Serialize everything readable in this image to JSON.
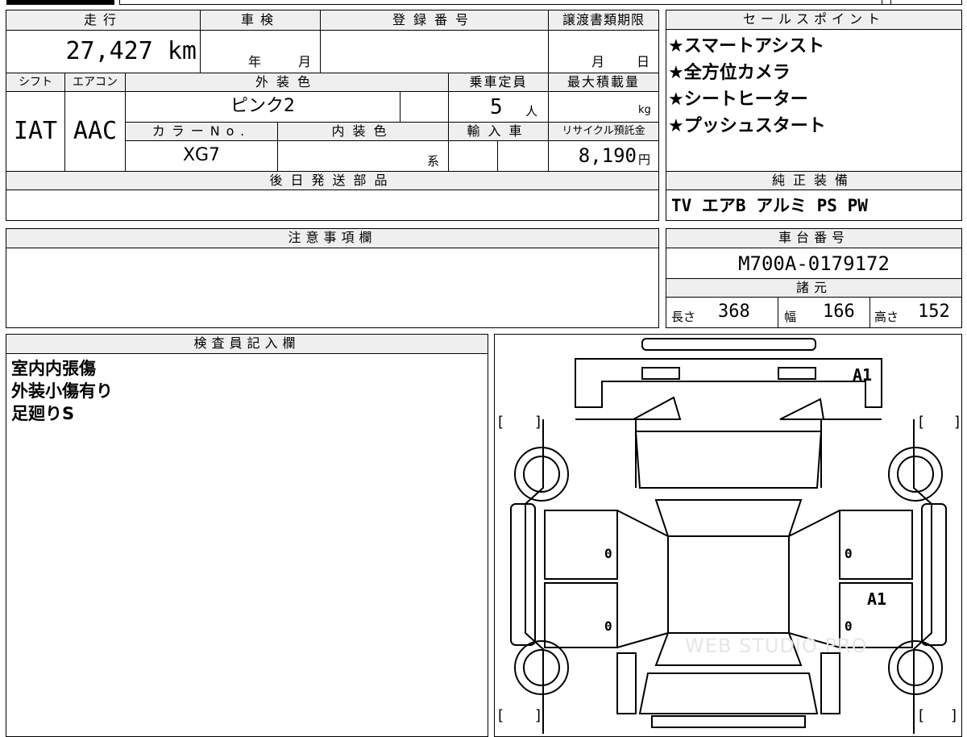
{
  "main": {
    "h_distance": "走行",
    "h_inspection": "車検",
    "h_registration": "登録番号",
    "h_transfer_deadline": "譲渡書類期限",
    "distance_value": "27,427",
    "distance_unit": "km",
    "insp_year": "年",
    "insp_month": "月",
    "transfer_month": "月",
    "transfer_day": "日",
    "h_shift": "シフト",
    "h_aircon": "エアコン",
    "h_exterior_color": "外装色",
    "h_capacity": "乗車定員",
    "h_max_load": "最大積載量",
    "shift_value": "IAT",
    "aircon_value": "AAC",
    "exterior_color_value": "ピンク2",
    "capacity_value": "5",
    "capacity_unit": "人",
    "max_load_unit": "kg",
    "h_color_no": "カラーNo.",
    "h_interior_color": "内装色",
    "h_import": "輸入車",
    "h_recycle": "リサイクル預託金",
    "color_no_value": "XG7",
    "interior_suffix": "系",
    "recycle_value": "8,190",
    "recycle_unit": "円",
    "h_later_parts": "後日発送部品"
  },
  "sales_points": {
    "header": "セールスポイント",
    "items": [
      "★スマートアシスト",
      "★全方位カメラ",
      "★シートヒーター",
      "★プッシュスタート"
    ]
  },
  "genuine_equipment": {
    "header": "純正装備",
    "value": "TV エアB アルミ PS PW"
  },
  "caution": {
    "header": "注意事項欄"
  },
  "chassis": {
    "header": "車台番号",
    "value": "M700A-0179172"
  },
  "specs": {
    "header": "諸元",
    "length_label": "長さ",
    "length_value": "368",
    "width_label": "幅",
    "width_value": "166",
    "height_label": "高さ",
    "height_value": "152"
  },
  "inspector": {
    "header": "検査員記入欄",
    "lines": [
      "室内内張傷",
      "外装小傷有り",
      "足廻りS"
    ]
  },
  "diagram": {
    "marks": [
      "A1",
      "0",
      "0",
      "A1",
      "0",
      "0"
    ],
    "brackets": [
      "[",
      "]",
      "[",
      "]",
      "[",
      "]",
      "[",
      "]"
    ],
    "watermark": "WEB STUDIO PRO"
  }
}
